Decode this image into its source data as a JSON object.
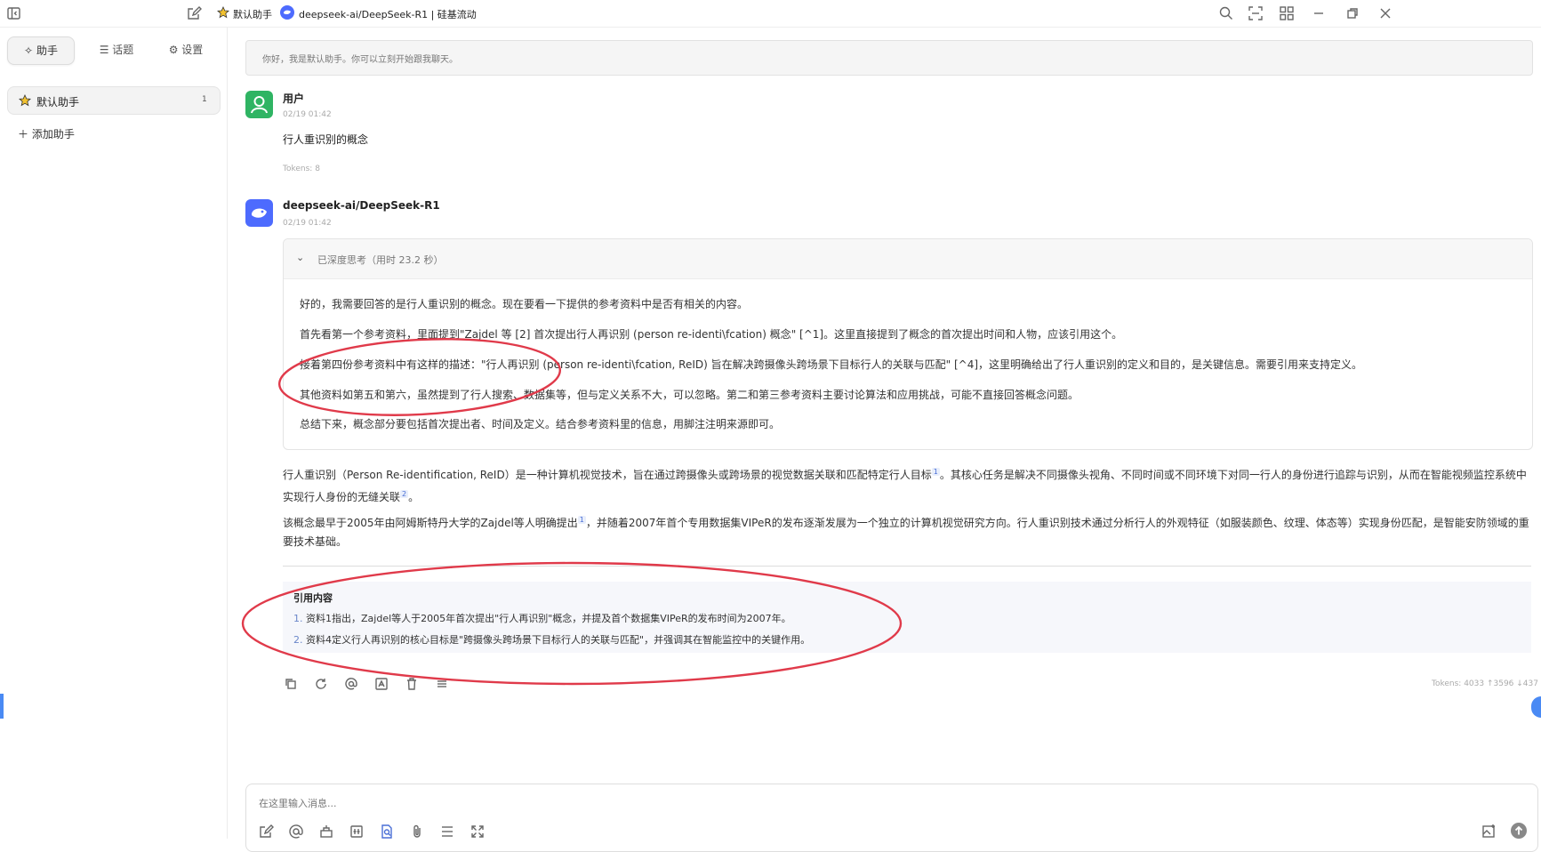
{
  "topbar": {
    "assistant_label": "默认助手",
    "model_label": "deepseek-ai/DeepSeek-R1 | 硅基流动"
  },
  "sidebar": {
    "tabs": [
      {
        "label": "助手",
        "icon": "sparkle-icon"
      },
      {
        "label": "话题",
        "icon": "list-icon"
      },
      {
        "label": "设置",
        "icon": "gear-icon"
      }
    ],
    "assistant": {
      "label": "默认助手",
      "count": "1"
    },
    "add_label": "添加助手"
  },
  "greeting": "你好，我是默认助手。你可以立刻开始跟我聊天。",
  "user_message": {
    "name": "用户",
    "time": "02/19 01:42",
    "text": "行人重识别的概念",
    "tokens": "Tokens: 8"
  },
  "assistant_message": {
    "name": "deepseek-ai/DeepSeek-R1",
    "time": "02/19 01:42",
    "think_header": "已深度思考（用时 23.2 秒）",
    "think_paragraphs": [
      "好的，我需要回答的是行人重识别的概念。现在要看一下提供的参考资料中是否有相关的内容。",
      "首先看第一个参考资料，里面提到\"Zajdel 等 [2] 首次提出行人再识别 (person re-identi\\fcation) 概念\" [^1]。这里直接提到了概念的首次提出时间和人物，应该引用这个。",
      "接着第四份参考资料中有这样的描述：\"行人再识别 (person re-identi\\fcation, ReID) 旨在解决跨摄像头跨场景下目标行人的关联与匹配\" [^4]，这里明确给出了行人重识别的定义和目的，是关键信息。需要引用来支持定义。",
      "其他资料如第五和第六，虽然提到了行人搜索、数据集等，但与定义关系不大，可以忽略。第二和第三参考资料主要讨论算法和应用挑战，可能不直接回答概念问题。",
      "总结下来，概念部分要包括首次提出者、时间及定义。结合参考资料里的信息，用脚注注明来源即可。"
    ],
    "answer_p1_a": "行人重识别（Person Re-identification, ReID）是一种计算机视觉技术，旨在通过跨摄像头或跨场景的视觉数据关联和匹配特定行人目标",
    "answer_p1_ref1": "1",
    "answer_p1_b": "。其核心任务是解决不同摄像头视角、不同时间或不同环境下对同一行人的身份进行追踪与识别，从而在智能视频监控系统中实现行人身份的无缝关联",
    "answer_p1_ref2": "2",
    "answer_p1_c": "。",
    "answer_p2_a": "该概念最早于2005年由阿姆斯特丹大学的Zajdel等人明确提出",
    "answer_p2_ref1": "1",
    "answer_p2_b": "，并随着2007年首个专用数据集VIPeR的发布逐渐发展为一个独立的计算机视觉研究方向。行人重识别技术通过分析行人的外观特征（如服装颜色、纹理、体态等）实现身份匹配，是智能安防领域的重要技术基础。",
    "cite_title": "引用内容",
    "cite_items": [
      {
        "num": "1.",
        "text": "资料1指出，Zajdel等人于2005年首次提出\"行人再识别\"概念，并提及首个数据集VIPeR的发布时间为2007年。"
      },
      {
        "num": "2.",
        "text": "资料4定义行人再识别的核心目标是\"跨摄像头跨场景下目标行人的关联与匹配\"，并强调其在智能监控中的关键作用。"
      }
    ],
    "tokens": "Tokens: 4033 ↑3596 ↓437"
  },
  "input": {
    "placeholder": "在这里输入消息..."
  },
  "colors": {
    "annotation_red": "#e03a4a",
    "user_avatar": "#2fb463",
    "model_avatar": "#4d6bfe",
    "citation_accent": "#4a6fd6"
  }
}
